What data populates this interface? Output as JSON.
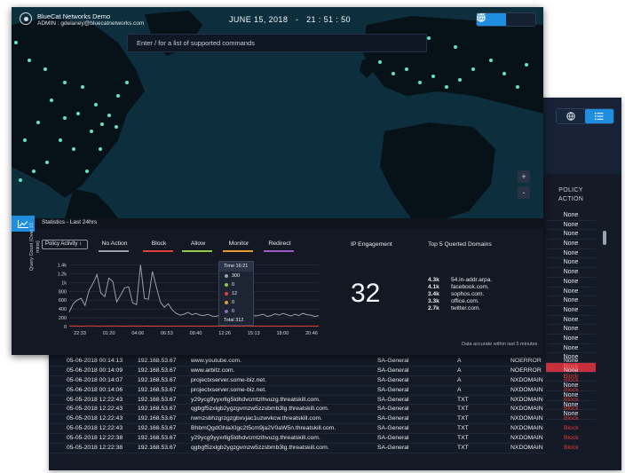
{
  "brand": {
    "title": "BlueCat Networks Demo",
    "user": "ADMIN : gdelaney@bluecatnetworks.com"
  },
  "datetime": {
    "date": "JUNE 15, 2018",
    "separator": "-",
    "time": "21 : 51 : 50"
  },
  "view_toggle": {
    "active": "globe-icon",
    "inactive": "list-icon",
    "accent": "#1f8de0"
  },
  "command_bar": {
    "placeholder": "Enter / for a list of supported commands"
  },
  "map_controls": {
    "zoom_in": "+",
    "zoom_out": "-"
  },
  "stats": {
    "title": "Statistics - Last 24hrs",
    "dropdown": "Policy Activity ↕",
    "legend": [
      {
        "label": "No Action",
        "color": "#9aa1ad"
      },
      {
        "label": "Block",
        "color": "#e0413a"
      },
      {
        "label": "Allow",
        "color": "#8fc84a"
      },
      {
        "label": "Monitor",
        "color": "#e79a32"
      },
      {
        "label": "Redirect",
        "color": "#9a5bc5"
      }
    ],
    "y_axis_label": "Query Count (Over 10 mins)",
    "tooltip": {
      "time": "Time 16:21",
      "rows": [
        {
          "value": "300",
          "color": "#9aa1ad"
        },
        {
          "value": "0",
          "color": "#8fc84a"
        },
        {
          "value": "12",
          "color": "#e0413a"
        },
        {
          "value": "0",
          "color": "#e79a32"
        },
        {
          "value": "0",
          "color": "#9a5bc5"
        }
      ],
      "total": "Total  312"
    },
    "ip_engagement": {
      "title": "IP Engagement",
      "value": "32"
    },
    "top_domains": {
      "title": "Top 5 Querted Domains",
      "items": [
        {
          "count": "4.3k",
          "domain": "54.in-addr.arpa."
        },
        {
          "count": "4.1k",
          "domain": "facebook.com."
        },
        {
          "count": "3.4k",
          "domain": "sophos.com."
        },
        {
          "count": "3.3k",
          "domain": "office.com."
        },
        {
          "count": "2.7k",
          "domain": "twitter.com."
        }
      ]
    },
    "footnote": "Data accurate within last 5 minutes"
  },
  "chart_data": {
    "type": "line",
    "title": "",
    "xlabel": "",
    "ylabel": "Query Count (Over 10 mins)",
    "x_ticks": [
      "22:33",
      "01:20",
      "04:06",
      "06:53",
      "09:40",
      "12:26",
      "15:13",
      "18:00",
      "20:46"
    ],
    "y_ticks": [
      "0",
      "200",
      "400",
      "600",
      "800",
      "1k",
      "1.2k",
      "1.4k"
    ],
    "ylim": [
      0,
      1450
    ],
    "series": [
      {
        "name": "No Action",
        "color": "#9aa1ad",
        "values": [
          330,
          520,
          600,
          640,
          480,
          820,
          980,
          1180,
          760,
          680,
          1100,
          1020,
          560,
          720,
          880,
          900,
          540,
          500,
          1400,
          640,
          620,
          1250,
          900,
          560,
          440,
          520,
          380,
          300,
          260,
          280,
          320,
          270,
          300,
          260,
          250,
          280,
          240,
          230,
          260,
          300,
          250,
          270,
          320,
          280,
          300,
          260,
          290,
          240,
          260,
          280,
          230,
          250,
          290,
          260,
          300,
          270,
          240,
          280,
          250,
          300,
          270,
          260,
          230,
          250
        ]
      },
      {
        "name": "Block",
        "color": "#e0413a",
        "values": [
          15,
          12,
          14,
          10,
          12,
          15,
          14,
          11,
          12,
          13,
          12,
          14,
          12,
          10,
          11,
          12,
          14,
          12,
          13,
          10,
          12,
          11,
          12,
          13,
          12,
          10,
          11,
          12,
          12,
          11,
          12,
          13,
          12,
          12,
          10,
          11,
          12,
          13,
          12,
          11,
          12,
          12,
          11,
          12,
          13,
          12,
          12,
          11,
          12,
          12,
          11,
          12,
          13,
          12,
          11,
          12,
          12,
          13,
          12,
          11,
          12,
          12,
          11,
          12
        ]
      }
    ],
    "legend_placement": "top",
    "grid": true
  },
  "back_window": {
    "policy_header": [
      "POLICY",
      "ACTION"
    ],
    "policy_values": [
      "None",
      "None",
      "None",
      "None",
      "None",
      "None",
      "None",
      "None",
      "None",
      "None",
      "None",
      "None",
      "None",
      "None",
      "None",
      "None",
      "Block",
      "Block",
      "None",
      "None",
      "None",
      "None"
    ],
    "policy_colors": {
      "none": "#e6e9ef",
      "block": "#e23b3b",
      "highlight": "#c72f3a"
    },
    "log_rows": [
      {
        "date": "05-06-2018 00:14:13",
        "ip": "192.168.53.67",
        "domain": "www.youtube.com.",
        "view": "SA-General",
        "type": "A",
        "response": "NOERROR",
        "policy": "None"
      },
      {
        "date": "05-06-2018 00:14:09",
        "ip": "192.168.53.67",
        "domain": "www.arbitz.com.",
        "view": "SA-General",
        "type": "A",
        "response": "NOERROR",
        "policy": "None"
      },
      {
        "date": "05-06-2018 00:14:07",
        "ip": "192.168.53.67",
        "domain": "projectxserver.some-biz.net.",
        "view": "SA-General",
        "type": "A",
        "response": "NXDOMAIN",
        "policy": "Block"
      },
      {
        "date": "05-06-2018 00:14:06",
        "ip": "192.168.53.67",
        "domain": "projectxserver.some-biz.net.",
        "view": "SA-General",
        "type": "A",
        "response": "NXDOMAIN",
        "policy": "Block"
      },
      {
        "date": "05-05-2018 12:22:43",
        "ip": "192.168.53.67",
        "domain": "y29ycg9yyxrllg5ldhdvcmtzlhvuzg.threatskill.com.",
        "view": "SA-General",
        "type": "TXT",
        "response": "NXDOMAIN",
        "policy": "Block"
      },
      {
        "date": "05-05-2018 12:22:43",
        "ip": "192.168.53.67",
        "domain": "qgbgf5zxlgb2ygzgvmzw5zzsbmb3lg.threatskill.com.",
        "view": "SA-General",
        "type": "TXT",
        "response": "NXDOMAIN",
        "policy": "Block"
      },
      {
        "date": "05-05-2018 12:22:43",
        "ip": "192.168.53.67",
        "domain": "rwmzsbhzgrzgzgbxvjac1uzwvkcw.threatskill.com.",
        "view": "SA-General",
        "type": "TXT",
        "response": "NXDOMAIN",
        "policy": "Block"
      },
      {
        "date": "05-05-2018 12:22:43",
        "ip": "192.168.53.67",
        "domain": "BhbmQgdGhlaXIgc2t5cm9ja2V0aW5n.threatskill.com.",
        "view": "SA-General",
        "type": "TXT",
        "response": "NXDOMAIN",
        "policy": "Block"
      },
      {
        "date": "05-05-2018 12:22:38",
        "ip": "192.168.53.67",
        "domain": "y29ycg9yyxrllg5ldhdvcmtzlhvuzg.threatskill.com.",
        "view": "SA-General",
        "type": "TXT",
        "response": "NXDOMAIN",
        "policy": "Block"
      },
      {
        "date": "05-05-2018 12:22:38",
        "ip": "192.168.53.67",
        "domain": "qgbgf5zxlgb2ygzgvmzw5zzsbmb3lg.threatskill.com.",
        "view": "SA-General",
        "type": "TXT",
        "response": "NXDOMAIN",
        "policy": "Block"
      }
    ]
  }
}
